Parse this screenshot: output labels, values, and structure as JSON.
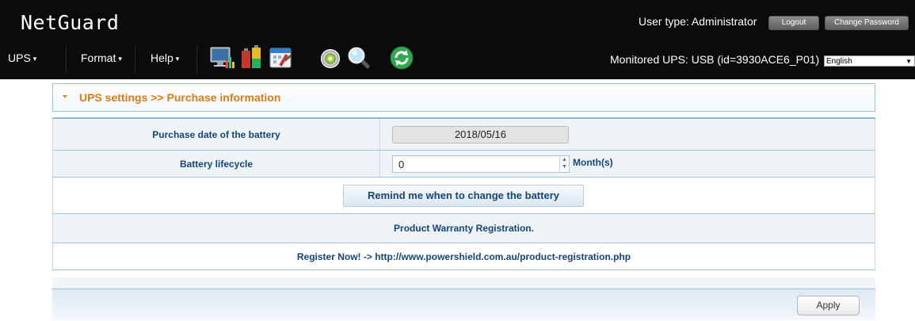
{
  "header": {
    "brand": "NetGuard",
    "user_type": "User type: Administrator",
    "logout_label": "Logout",
    "change_password_label": "Change Password",
    "menus": [
      {
        "label": "UPS"
      },
      {
        "label": "Format"
      },
      {
        "label": "Help"
      }
    ],
    "toolbar_icons": [
      "monitor-chart-icon",
      "battery-status-icon",
      "calendar-settings-icon",
      "gear-icon",
      "search-icon",
      "refresh-icon"
    ],
    "monitored": "Monitored UPS: USB (id=3930ACE6_P01)",
    "language": "English"
  },
  "page": {
    "section_title": "UPS settings >> Purchase information",
    "purchase_date_label": "Purchase date of the battery",
    "purchase_date_value": "2018/05/16",
    "lifecycle_label": "Battery lifecycle",
    "lifecycle_value": "0",
    "lifecycle_unit": "Month(s)",
    "remind_button": "Remind me when to change the battery",
    "warranty_text": "Product Warranty Registration.",
    "register_text": "Register Now! -> http://www.powershield.com.au/product-registration.php",
    "apply_label": "Apply"
  },
  "colors": {
    "header_bg": "#0b0b0b",
    "title_orange": "#e07b14",
    "label_blue": "#14467c",
    "border_blue": "#9fc4de"
  }
}
